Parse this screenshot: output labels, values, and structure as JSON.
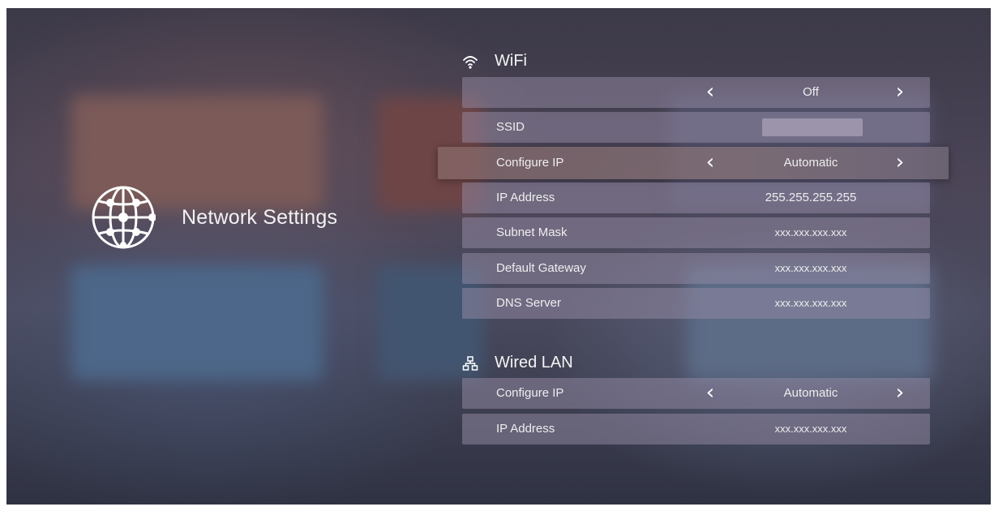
{
  "page": {
    "title": "Network Settings"
  },
  "icons": {
    "main": "globe-network-icon",
    "wifi": "wifi-icon",
    "lan": "wired-lan-icon",
    "prev": "chevron-left-icon",
    "next": "chevron-right-icon"
  },
  "wifi": {
    "section_title": "WiFi",
    "status_value": "Off",
    "rows": {
      "ssid": {
        "label": "SSID",
        "value": ""
      },
      "configure_ip": {
        "label": "Configure IP",
        "value": "Automatic"
      },
      "ip_address": {
        "label": "IP Address",
        "value": "255.255.255.255"
      },
      "subnet_mask": {
        "label": "Subnet Mask",
        "value": "xxx.xxx.xxx.xxx"
      },
      "default_gateway": {
        "label": "Default Gateway",
        "value": "xxx.xxx.xxx.xxx"
      },
      "dns_server": {
        "label": "DNS Server",
        "value": "xxx.xxx.xxx.xxx"
      }
    }
  },
  "lan": {
    "section_title": "Wired LAN",
    "rows": {
      "configure_ip": {
        "label": "Configure IP",
        "value": "Automatic"
      },
      "ip_address": {
        "label": "IP Address",
        "value": "xxx.xxx.xxx.xxx"
      }
    }
  },
  "arrows": {
    "left": "‹",
    "right": "›"
  }
}
